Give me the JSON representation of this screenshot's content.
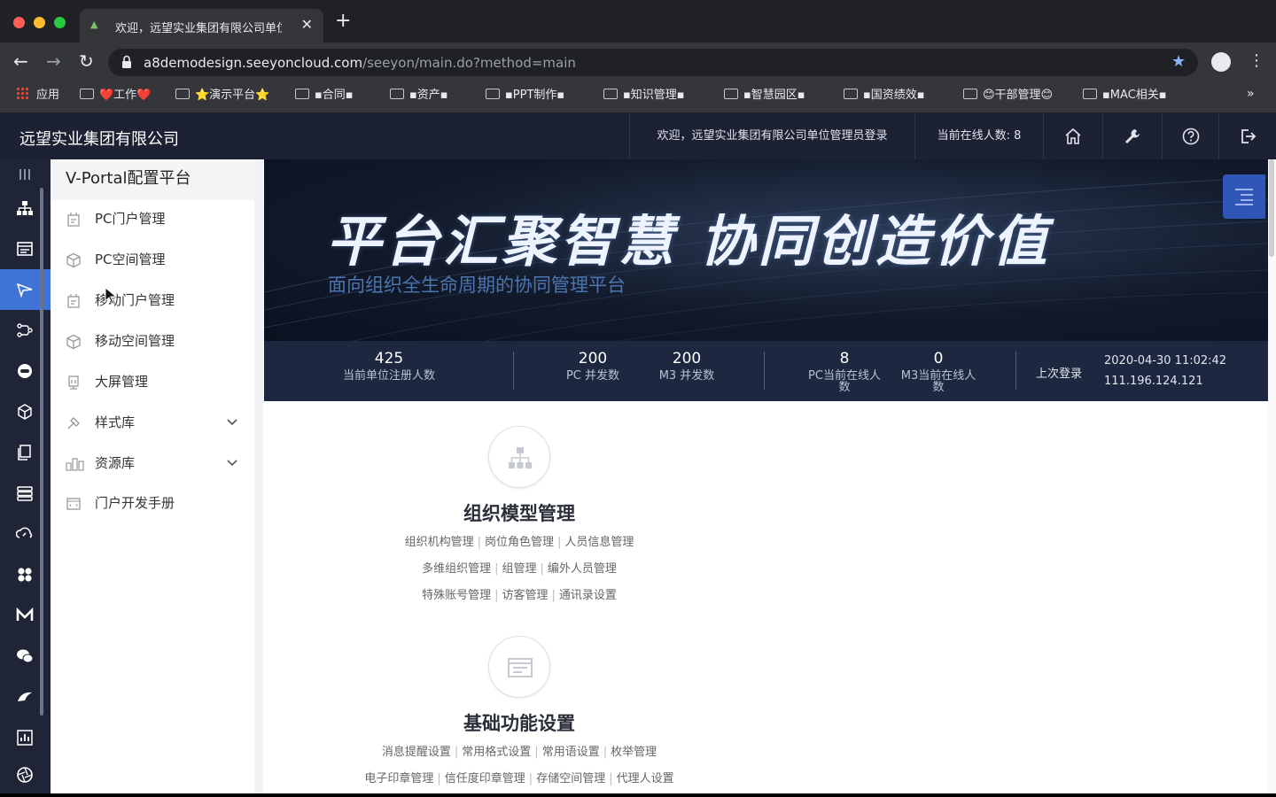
{
  "browser": {
    "tab_title": "欢迎，远望实业集团有限公司单位",
    "url_host": "a8demodesign.seeyoncloud.com",
    "url_path": "/seeyon/main.do?method=main",
    "bookmarks": [
      {
        "label": "应用",
        "icon": "apps-grid-icon"
      },
      {
        "label": "❤️工作❤️",
        "icon": "folder-icon"
      },
      {
        "label": "⭐演示平台⭐",
        "icon": "folder-icon"
      },
      {
        "label": "▪合同▪",
        "icon": "folder-icon"
      },
      {
        "label": "▪资产▪",
        "icon": "folder-icon"
      },
      {
        "label": "▪PPT制作▪",
        "icon": "folder-icon"
      },
      {
        "label": "▪知识管理▪",
        "icon": "folder-icon"
      },
      {
        "label": "▪智慧园区▪",
        "icon": "folder-icon"
      },
      {
        "label": "▪国资绩效▪",
        "icon": "folder-icon"
      },
      {
        "label": "😊干部管理😊",
        "icon": "folder-icon"
      },
      {
        "label": "▪MAC相关▪",
        "icon": "folder-icon"
      }
    ],
    "more": "»"
  },
  "header": {
    "brand": "远望实业集团有限公司",
    "welcome": "欢迎，远望实业集团有限公司单位管理员登录",
    "online": "当前在线人数: 8"
  },
  "submenu": {
    "title": "V-Portal配置平台",
    "items": [
      {
        "label": "PC门户管理",
        "icon": "portal-icon"
      },
      {
        "label": "PC空间管理",
        "icon": "cube-icon"
      },
      {
        "label": "移动门户管理",
        "icon": "portal-icon"
      },
      {
        "label": "移动空间管理",
        "icon": "cube-icon"
      },
      {
        "label": "大屏管理",
        "icon": "screen-icon"
      },
      {
        "label": "样式库",
        "icon": "brush-icon"
      },
      {
        "label": "资源库",
        "icon": "resource-icon"
      },
      {
        "label": "门户开发手册",
        "icon": "manual-icon"
      }
    ]
  },
  "banner": {
    "slogan": "平台汇聚智慧 协同创造价值",
    "subslogan": "面向组织全生命周期的协同管理平台"
  },
  "stats": {
    "registered": {
      "value": "425",
      "label": "当前单位注册人数"
    },
    "pc_concurrent": {
      "value": "200",
      "label": "PC 并发数"
    },
    "m3_concurrent": {
      "value": "200",
      "label": "M3 并发数"
    },
    "pc_online": {
      "value": "8",
      "label": "PC当前在线人数"
    },
    "m3_online": {
      "value": "0",
      "label": "M3当前在线人数"
    },
    "last_login_label": "上次登录",
    "last_login_time": "2020-04-30 11:02:42",
    "last_login_ip": "111.196.124.121"
  },
  "sections": [
    {
      "title": "组织模型管理",
      "icon": "org-chart-icon",
      "rows": [
        [
          "组织机构管理",
          "岗位角色管理",
          "人员信息管理"
        ],
        [
          "多维组织管理",
          "组管理",
          "编外人员管理"
        ],
        [
          "特殊账号管理",
          "访客管理",
          "通讯录设置"
        ]
      ]
    },
    {
      "title": "基础功能设置",
      "icon": "settings-panel-icon",
      "rows": [
        [
          "消息提醒设置",
          "常用格式设置",
          "常用语设置",
          "枚举管理"
        ],
        [
          "电子印章管理",
          "信任度印章管理",
          "存储空间管理",
          "代理人设置"
        ]
      ]
    }
  ],
  "colors": {
    "header_bg": "#1c2233",
    "rail_bg": "#1f2536",
    "rail_active": "#3f74d6",
    "stat_bar": "#1d2740"
  }
}
